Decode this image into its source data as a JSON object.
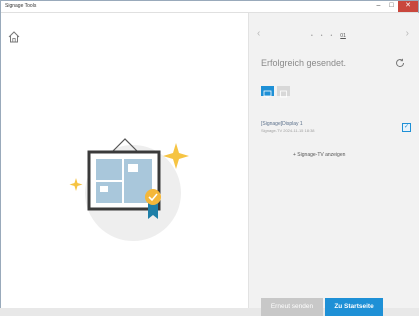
{
  "window": {
    "title": "Signage Tools",
    "controls": {
      "minimize": "–",
      "maximize": "□",
      "close": "✕"
    }
  },
  "nav": {
    "prev": "‹",
    "next": "›",
    "pages": [
      "•",
      "•",
      "•",
      "01"
    ]
  },
  "status": {
    "title": "Erfolgreich gesendet."
  },
  "device": {
    "name": "[Signage]Display 1",
    "meta": "Signage-TV 2024-11-15 18:38",
    "checked": "✓"
  },
  "show_link": "+ Signage-TV anzeigen",
  "buttons": {
    "resend": "Erneut senden",
    "home": "Zu Startseite"
  },
  "colors": {
    "accent": "#1e90d6",
    "star": "#f6c443"
  }
}
